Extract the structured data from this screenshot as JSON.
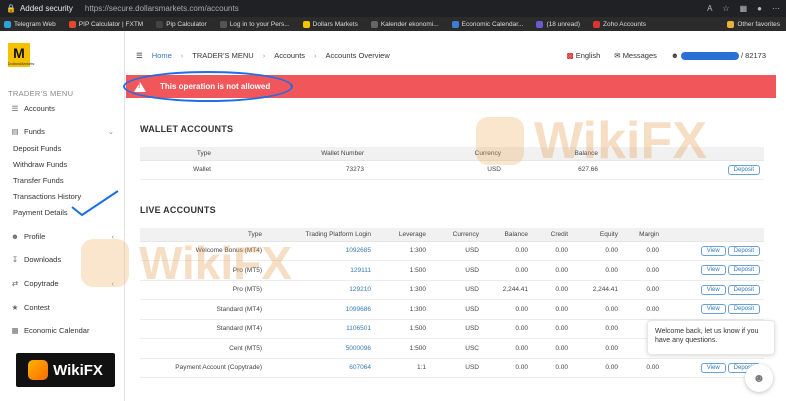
{
  "browser": {
    "security": "Added security",
    "url": "https://secure.dollarsmarkets.com/accounts",
    "bookmarks": [
      "Telegram Web",
      "PIP Calculator | FXTM",
      "Pip Calculator",
      "Log in to your Pers...",
      "Dollars Markets",
      "Kalender ekonomi...",
      "Economic Calendar...",
      "(18 unread)",
      "Zoho Accounts"
    ],
    "other_favorites": "Other favorites"
  },
  "sidebar": {
    "logo_letter": "M",
    "logo_caption": "DollarsMarkets",
    "menu_title": "TRADER'S MENU",
    "accounts": "Accounts",
    "funds": "Funds",
    "fund_items": [
      "Deposit Funds",
      "Withdraw Funds",
      "Transfer Funds",
      "Transactions History",
      "Payment Details"
    ],
    "profile": "Profile",
    "downloads": "Downloads",
    "copytrade": "Copytrade",
    "contest": "Contest",
    "calendar": "Economic Calendar",
    "wikifx": "WikiFX"
  },
  "header": {
    "home": "Home",
    "traders_menu": "TRADER'S MENU",
    "accounts": "Accounts",
    "overview": "Accounts Overview",
    "language": "English",
    "messages": "Messages",
    "user_suffix": "/ 82173"
  },
  "alert": {
    "message": "This operation is not allowed"
  },
  "wallet": {
    "title": "WALLET ACCOUNTS",
    "headers": [
      "Type",
      "Wallet Number",
      "Currency",
      "Balance"
    ],
    "row": {
      "type": "Wallet",
      "number": "73273",
      "currency": "USD",
      "balance": "627.66",
      "deposit": "Deposit"
    }
  },
  "live": {
    "title": "LIVE ACCOUNTS",
    "headers": [
      "Type",
      "Trading Platform Login",
      "Leverage",
      "Currency",
      "Balance",
      "Credit",
      "Equity",
      "Margin"
    ],
    "rows": [
      {
        "type": "Welcome Bonus (MT4)",
        "login": "1092685",
        "leverage": "1:300",
        "currency": "USD",
        "balance": "0.00",
        "credit": "0.00",
        "equity": "0.00",
        "margin": "0.00"
      },
      {
        "type": "Pro (MT5)",
        "login": "129111",
        "leverage": "1:500",
        "currency": "USD",
        "balance": "0.00",
        "credit": "0.00",
        "equity": "0.00",
        "margin": "0.00"
      },
      {
        "type": "Pro (MT5)",
        "login": "129210",
        "leverage": "1:300",
        "currency": "USD",
        "balance": "2,244.41",
        "credit": "0.00",
        "equity": "2,244.41",
        "margin": "0.00"
      },
      {
        "type": "Standard (MT4)",
        "login": "1099686",
        "leverage": "1:300",
        "currency": "USD",
        "balance": "0.00",
        "credit": "0.00",
        "equity": "0.00",
        "margin": "0.00"
      },
      {
        "type": "Standard (MT4)",
        "login": "1106501",
        "leverage": "1:500",
        "currency": "USD",
        "balance": "0.00",
        "credit": "0.00",
        "equity": "0.00",
        "margin": ""
      },
      {
        "type": "Cent (MT5)",
        "login": "5000096",
        "leverage": "1:500",
        "currency": "USC",
        "balance": "0.00",
        "credit": "0.00",
        "equity": "0.00",
        "margin": ""
      },
      {
        "type": "Payment Account (Copytrade)",
        "login": "607064",
        "leverage": "1:1",
        "currency": "USD",
        "balance": "0.00",
        "credit": "0.00",
        "equity": "0.00",
        "margin": "0.00"
      }
    ],
    "view_label": "View",
    "deposit_label": "Deposit"
  },
  "chat": {
    "message": "Welcome back, let us know if you have any questions."
  },
  "watermark": {
    "text": "WikiFX"
  }
}
